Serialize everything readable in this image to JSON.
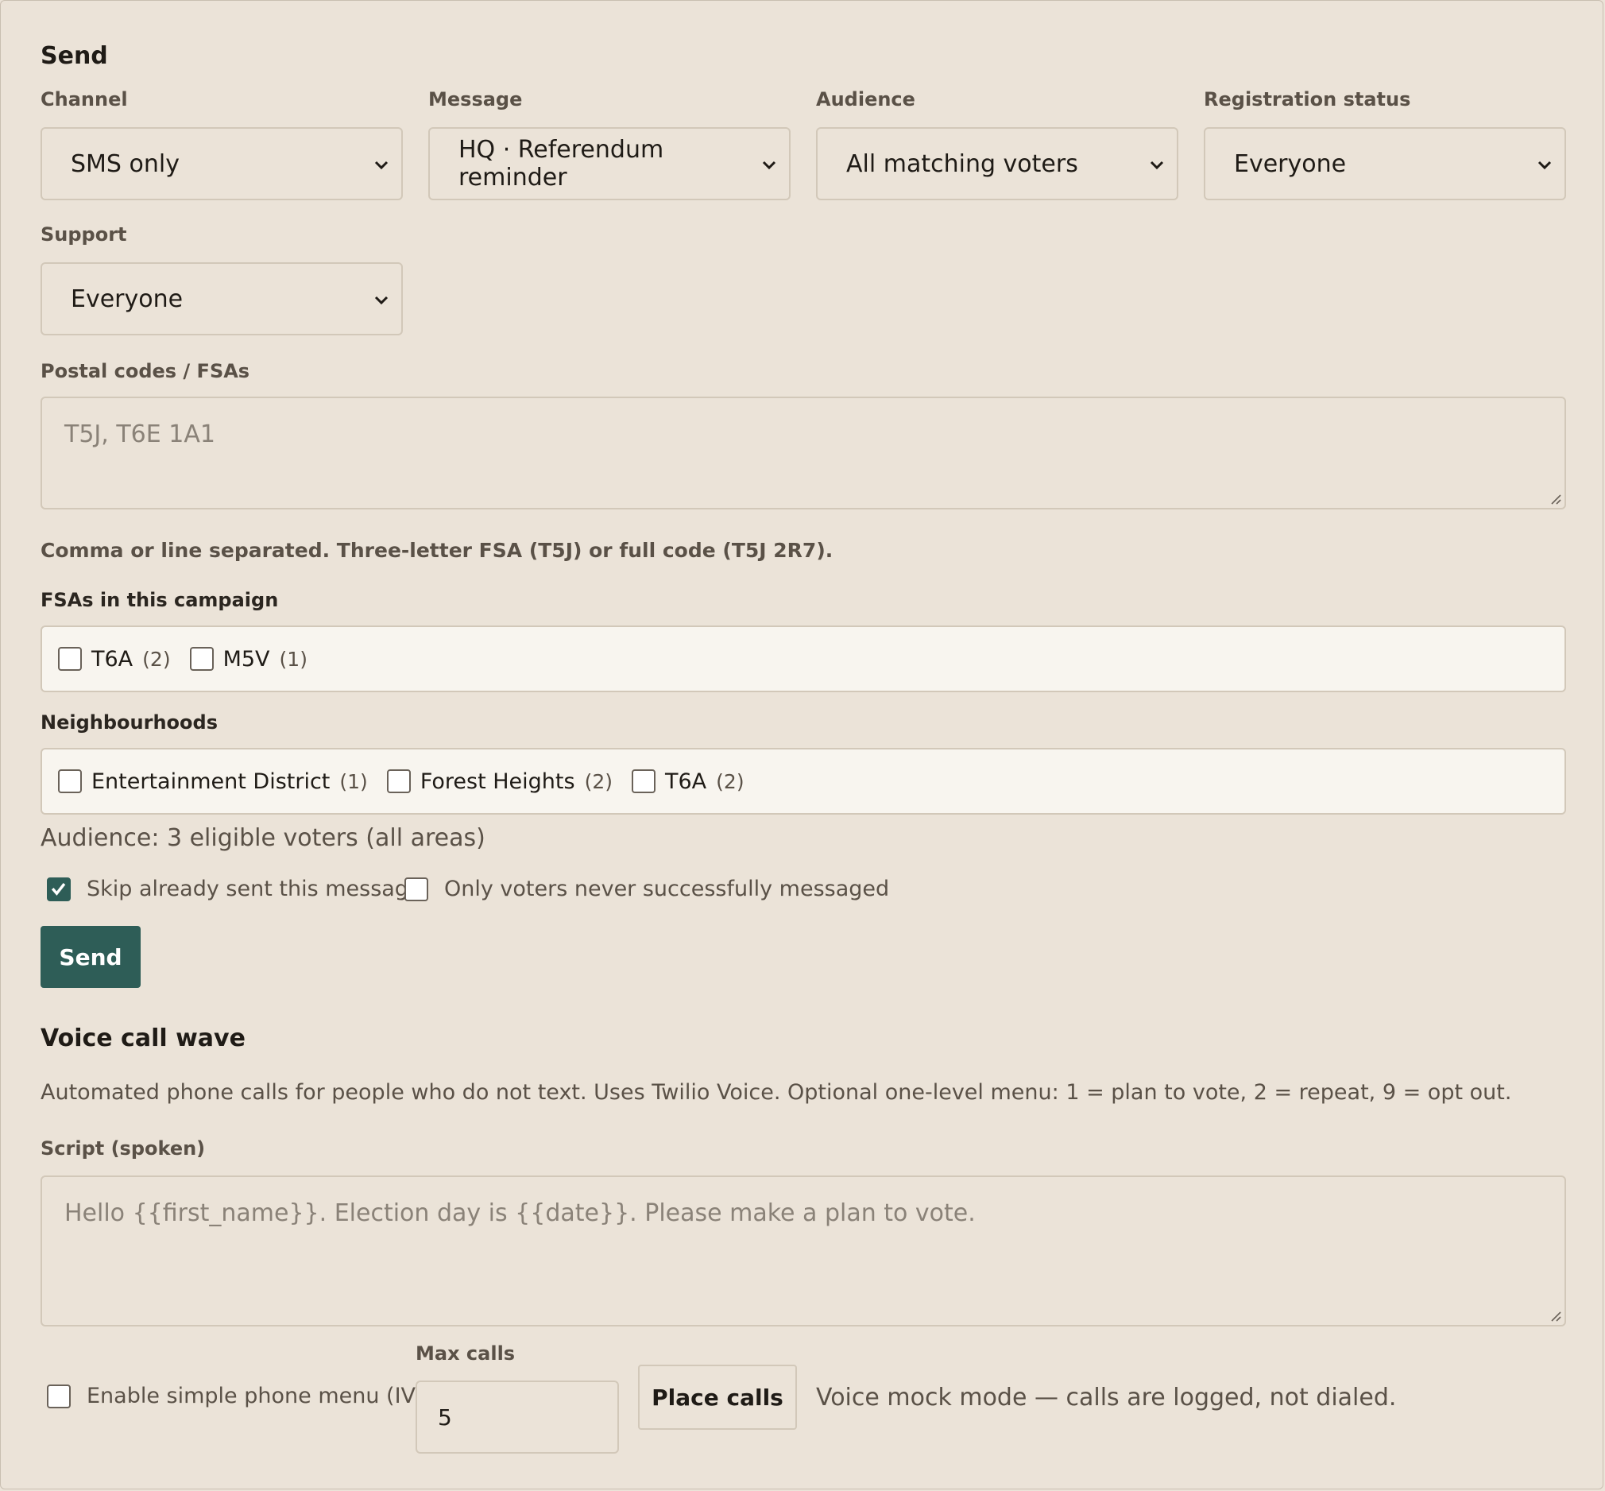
{
  "send": {
    "heading": "Send",
    "channel": {
      "label": "Channel",
      "value": "SMS only"
    },
    "message": {
      "label": "Message",
      "value": "HQ · Referendum reminder"
    },
    "audience_select": {
      "label": "Audience",
      "value": "All matching voters"
    },
    "registration": {
      "label": "Registration status",
      "value": "Everyone"
    },
    "support": {
      "label": "Support",
      "value": "Everyone"
    },
    "postal": {
      "label": "Postal codes / FSAs",
      "placeholder": "T5J, T6E 1A1",
      "hint": "Comma or line separated. Three-letter FSA (T5J) or full code (T5J 2R7)."
    },
    "fsas": {
      "label": "FSAs in this campaign",
      "items": [
        {
          "name": "T6A",
          "count": "(2)"
        },
        {
          "name": "M5V",
          "count": "(1)"
        }
      ]
    },
    "neighbourhoods": {
      "label": "Neighbourhoods",
      "items": [
        {
          "name": "Entertainment District",
          "count": "(1)"
        },
        {
          "name": "Forest Heights",
          "count": "(2)"
        },
        {
          "name": "T6A",
          "count": "(2)"
        }
      ]
    },
    "audience_summary": "Audience: 3 eligible voters (all areas)",
    "skip_sent": {
      "label": "Skip already sent this message",
      "checked": true
    },
    "only_never": {
      "label": "Only voters never successfully messaged",
      "checked": false
    },
    "send_button": "Send"
  },
  "voice": {
    "heading": "Voice call wave",
    "description": "Automated phone calls for people who do not text. Uses Twilio Voice. Optional one-level menu: 1 = plan to vote, 2 = repeat, 9 = opt out.",
    "script": {
      "label": "Script (spoken)",
      "placeholder": "Hello {{first_name}}. Election day is {{date}}. Please make a plan to vote."
    },
    "ivr": {
      "label": "Enable simple phone menu (IVR)",
      "checked": false
    },
    "max_calls": {
      "label": "Max calls",
      "value": "5"
    },
    "place_calls_button": "Place calls",
    "mock_note": "Voice mock mode — calls are logged, not dialed."
  },
  "colors": {
    "background": "#ebe3d8",
    "primary": "#2e5d57",
    "box_background": "#f8f5ef"
  }
}
